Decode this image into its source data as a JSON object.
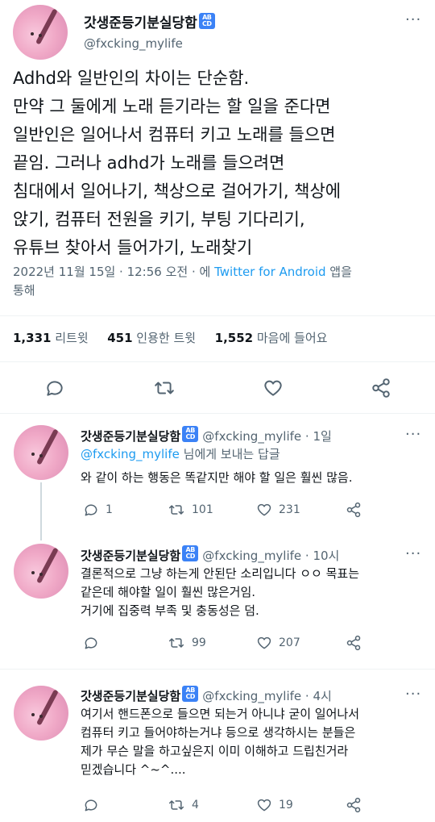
{
  "main_tweet": {
    "display_name": "갓생준등기분실당함",
    "badge": "ABCD",
    "handle": "@fxcking_mylife",
    "more": "···",
    "lines": [
      "Adhd와 일반인의 차이는 단순함.",
      "만약 그 둘에게 노래 듣기라는 할 일을 준다면",
      "일반인은 일어나서 컴퓨터 키고 노래를 들으면",
      "끝임. 그러나 adhd가 노래를 들으려면",
      "침대에서 일어나기, 책상으로 걸어가기, 책상에",
      "앉기, 컴퓨터 전원을 키기, 부팅 기다리기,",
      "유튜브 찾아서 들어가기, 노래찾기"
    ],
    "timestamp": "2022년 11월 15일 · 12:56 오전 · 에",
    "source": "Twitter for Android",
    "via_suffix": "앱을",
    "via_line2": "통해",
    "stats": [
      {
        "num": "1,331",
        "label": "리트윗"
      },
      {
        "num": "451",
        "label": "인용한 트윗"
      },
      {
        "num": "1,552",
        "label": "마음에 들어요"
      }
    ]
  },
  "replies": [
    {
      "display_name": "갓생준등기분실당함",
      "badge": "ABCD",
      "handle_time": "@fxcking_mylife · 1일",
      "more": "···",
      "reply_to_handle": "@fxcking_mylife",
      "reply_to_suffix": "님에게 보내는 답글",
      "lines": [
        "와 같이 하는 행동은 똑같지만 해야 할 일은 훨씬 많음."
      ],
      "reply_count": "1",
      "retweet_count": "101",
      "like_count": "231"
    },
    {
      "display_name": "갓생준등기분실당함",
      "badge": "ABCD",
      "handle_time": "@fxcking_mylife · 10시",
      "more": "···",
      "lines": [
        "결론적으로 그냥 하는게 안된단 소리입니다 ㅇㅇ 목표는",
        "같은데 해야할 일이 훨씬 많은거임.",
        "거기에 집중력 부족 및 충동성은 덤."
      ],
      "reply_count": "",
      "retweet_count": "99",
      "like_count": "207"
    },
    {
      "display_name": "갓생준등기분실당함",
      "badge": "ABCD",
      "handle_time": "@fxcking_mylife · 4시",
      "more": "···",
      "lines": [
        "여기서 핸드폰으로 들으면 되는거 아니냐 굳이 일어나서",
        "컴퓨터 키고 들어야하는거냐 등으로 생각하시는 분들은",
        "제가 무슨 말을 하고싶은지 이미 이해하고 드립친거라",
        "믿겠습니다 ^~^...."
      ],
      "reply_count": "",
      "retweet_count": "4",
      "like_count": "19"
    }
  ]
}
